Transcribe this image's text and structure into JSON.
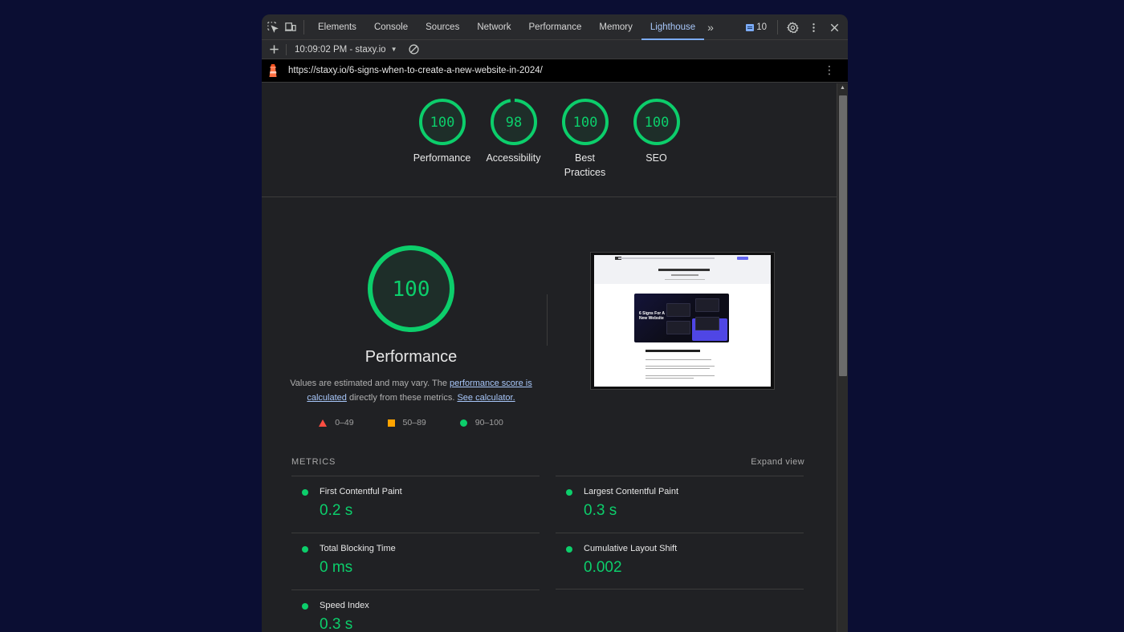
{
  "devtools": {
    "tabs": [
      {
        "label": "Elements",
        "active": false
      },
      {
        "label": "Console",
        "active": false
      },
      {
        "label": "Sources",
        "active": false
      },
      {
        "label": "Network",
        "active": false
      },
      {
        "label": "Performance",
        "active": false
      },
      {
        "label": "Memory",
        "active": false
      },
      {
        "label": "Lighthouse",
        "active": true
      }
    ],
    "more_tabs_icon": "chevron-double-right-icon",
    "issues_count": "10",
    "icons": [
      "inspect-element-icon",
      "device-toolbar-icon",
      "issues-message-icon",
      "gear-icon",
      "kebab-menu-icon",
      "close-icon"
    ]
  },
  "toolbar": {
    "report_label": "10:09:02 PM - staxy.io",
    "icons": [
      "plus-icon",
      "dropdown-caret-icon",
      "clear-block-icon"
    ]
  },
  "urlbar": {
    "url": "https://staxy.io/6-signs-when-to-create-a-new-website-in-2024/"
  },
  "categories": [
    {
      "label": "Performance",
      "score": 100
    },
    {
      "label": "Accessibility",
      "score": 98
    },
    {
      "label": "Best Practices",
      "score": 100
    },
    {
      "label": "SEO",
      "score": 100
    }
  ],
  "performance": {
    "title": "Performance",
    "score": 100,
    "desc_prefix": "Values are estimated and may vary. The ",
    "link_score": "performance score is calculated",
    "desc_middle": " directly from these metrics. ",
    "link_calc": "See calculator.",
    "legend": [
      {
        "range": "0–49",
        "shape": "triangle",
        "color": "#ff4e42"
      },
      {
        "range": "50–89",
        "shape": "square",
        "color": "#ffa400"
      },
      {
        "range": "90–100",
        "shape": "circle",
        "color": "#0cce6b"
      }
    ]
  },
  "screenshot": {
    "card_title": "6 Signs For A New Website",
    "heading": "Create a new website — Quick Word."
  },
  "metrics": {
    "header": "METRICS",
    "expand_label": "Expand view",
    "items": [
      {
        "name": "First Contentful Paint",
        "value": "0.2 s"
      },
      {
        "name": "Largest Contentful Paint",
        "value": "0.3 s"
      },
      {
        "name": "Total Blocking Time",
        "value": "0 ms"
      },
      {
        "name": "Cumulative Layout Shift",
        "value": "0.002"
      },
      {
        "name": "Speed Index",
        "value": "0.3 s"
      }
    ]
  },
  "colors": {
    "pass": "#0cce6b",
    "average": "#ffa400",
    "fail": "#ff4e42",
    "link": "#a8c7fa",
    "active_tab": "#7cacf8"
  }
}
